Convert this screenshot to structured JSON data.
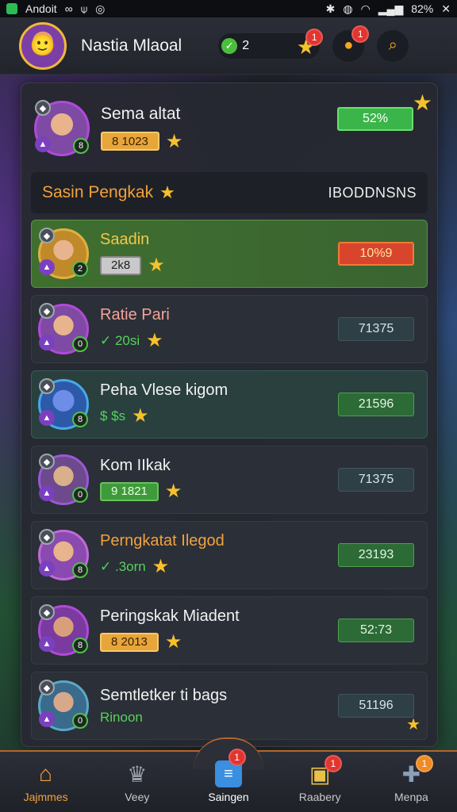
{
  "status_bar": {
    "left_text": "Andoit",
    "battery": "82%",
    "icons": [
      "app-badge-icon",
      "infinity-icon",
      "pin-icon",
      "cast-icon",
      "bluetooth-icon",
      "data-icon",
      "wifi-icon",
      "signal-icon",
      "close-icon"
    ]
  },
  "header": {
    "player_name": "Nastia Mlaoal",
    "gems": "2",
    "notif_a": "1",
    "notif_b": "1"
  },
  "my_card": {
    "name": "Sema altat",
    "score": "8 1023",
    "value": "52%"
  },
  "section": {
    "title": "Sasin Pengkak",
    "sort_label": "IBODDNSNS"
  },
  "rows": [
    {
      "name": "Saadin",
      "badge": "2k8",
      "value": "10%9"
    },
    {
      "name": "Ratie Pari",
      "sub": "✓ 20si",
      "value": "71375"
    },
    {
      "name": "Peha Vlese kigom",
      "sub": "$ $s",
      "value": "21596"
    },
    {
      "name": "Kom IIkak",
      "badge": "9 1821",
      "value": "71375"
    },
    {
      "name": "Perngkatat Ilegod",
      "sub": "✓ .3orn",
      "value": "23193"
    },
    {
      "name": "Peringskak Miadent",
      "badge": "8 2013",
      "value": "52:73"
    },
    {
      "name": "Semtletker ti bags",
      "sub": "Rinoon",
      "value": "51196"
    }
  ],
  "nav": {
    "items": [
      {
        "label": "Jajmmes"
      },
      {
        "label": "Veey"
      },
      {
        "label": "Saingen",
        "badge": "1"
      },
      {
        "label": "Raabery",
        "badge": "1"
      },
      {
        "label": "Menpa",
        "badge": "1"
      }
    ]
  },
  "colors": {
    "accent_orange": "#f2a23c",
    "accent_gold": "#f6c12a",
    "green": "#3ab54a",
    "red_badge": "#e3342f"
  }
}
